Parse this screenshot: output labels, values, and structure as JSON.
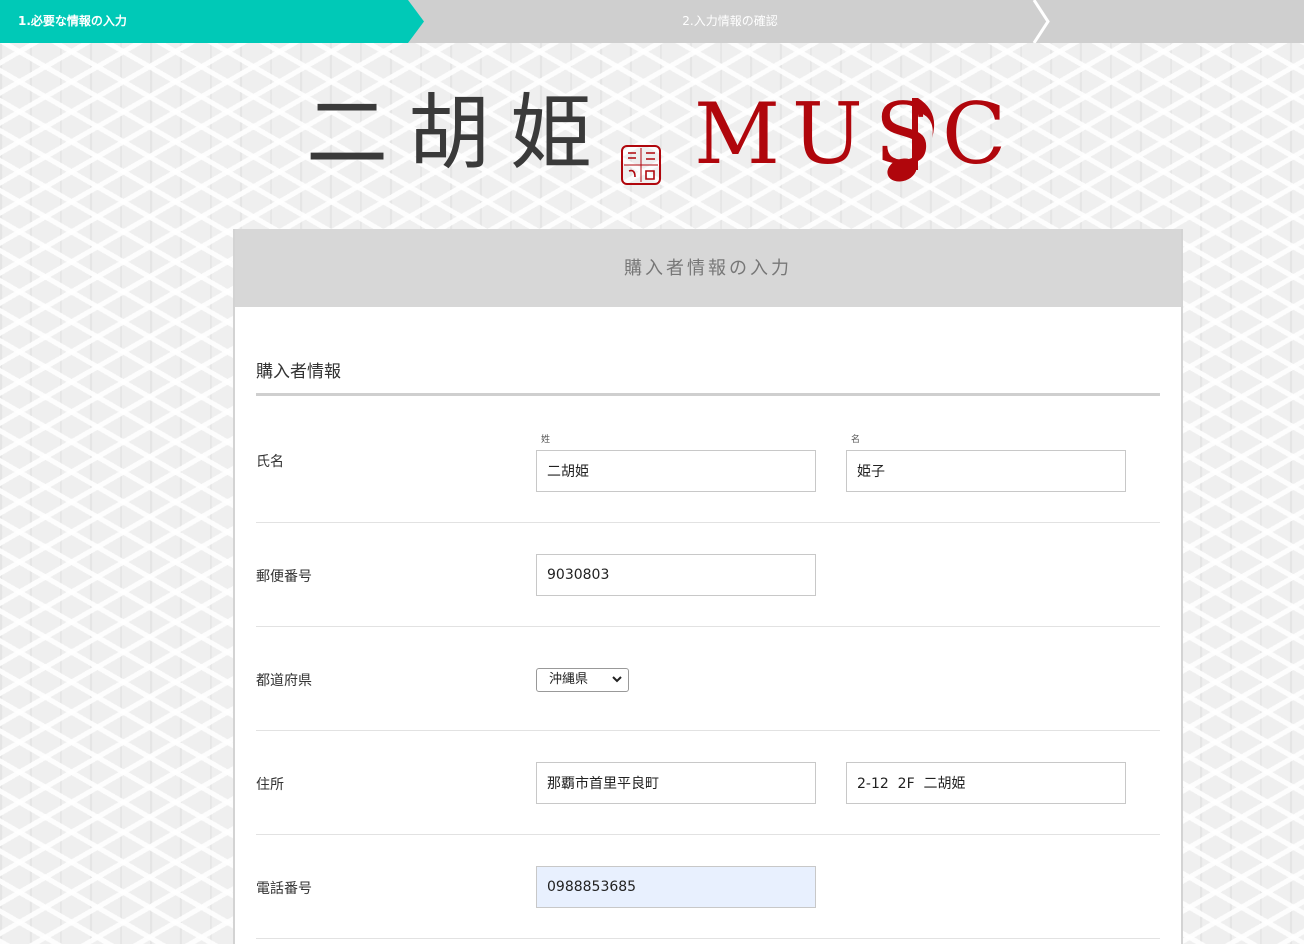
{
  "steps": [
    {
      "label": "1.必要な情報の入力",
      "active": true
    },
    {
      "label": "2.入力情報の確認",
      "active": false
    },
    {
      "label": "",
      "active": false
    }
  ],
  "logo": {
    "kanji": "二胡姫",
    "music_left": "MUS",
    "music_right": "C",
    "seal_icon": "seal-stamp-icon",
    "note_icon": "eighth-note-icon",
    "brand_color": "#b0060c"
  },
  "panel": {
    "header": "購入者情報の入力",
    "section_title": "購入者情報"
  },
  "form": {
    "name": {
      "label": "氏名",
      "last_caption": "姓",
      "first_caption": "名",
      "last_value": "二胡姫",
      "first_value": "姫子"
    },
    "postal": {
      "label": "郵便番号",
      "value": "9030803"
    },
    "prefecture": {
      "label": "都道府県",
      "selected": "沖縄県"
    },
    "address": {
      "label": "住所",
      "line1": "那覇市首里平良町",
      "line2": "2-12  2F  二胡姫"
    },
    "phone": {
      "label": "電話番号",
      "value": "0988853685"
    }
  },
  "colors": {
    "step_active": "#00c9b7",
    "step_inactive": "#cfcfcf"
  }
}
